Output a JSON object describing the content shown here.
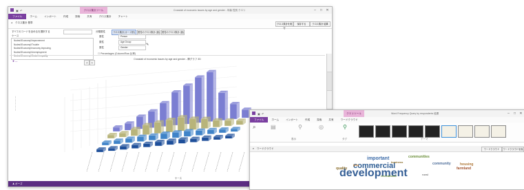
{
  "window1": {
    "title": "Crosstab of economic issues by age and gender - 年齢 性別 クエリ",
    "context_tab": "クロス集計ツール",
    "tabs": [
      "ファイル",
      "ホーム",
      "インポート",
      "作成",
      "探索",
      "共有",
      "クロス集計",
      "チャート"
    ],
    "query_label": "クロス集計 基準",
    "checkbox_label": "すべてのコードを含めるを選択する",
    "codes_label": "ケース",
    "codes": [
      "Nodes\\\\Economy\\\\Improvement",
      "Nodes\\\\Economy\\\\Trouble",
      "Nodes\\\\Economy\\\\economy improving",
      "Nodes\\\\Economy\\\\Unemployment",
      "Nodes\\\\Economy\\\\Social Inequality"
    ],
    "attributes_label": "分類属性",
    "attribute_rows": [
      {
        "label": "属性",
        "value": "Person"
      },
      {
        "label": "属性",
        "value": "Age Group"
      },
      {
        "label": "属性",
        "value": "Gender"
      }
    ],
    "buttons": {
      "b1": "クロス集計 (ケース別)",
      "b2": "属性のクロス集計 (値)",
      "b3": "属性のクロス集計 (値)",
      "run": "クロス集計を実行",
      "save": "保存する",
      "results": "クロス集計 結果"
    },
    "percent_label": "Percentages (Column/Row 比率)",
    "chart_title": "Crosstab of economic issues by age and gender - 棒グラフ 3D",
    "right_tabs": [
      "サマリー",
      "チャート",
      "マトリックス"
    ],
    "status": "ポーズ",
    "axis_label": "ケース"
  },
  "window2": {
    "title": "Word Frequency Query by respondents 結果",
    "context_tab": "クエリツール",
    "tabs": [
      "ファイル",
      "ホーム",
      "インポート",
      "作成",
      "探索",
      "共有",
      "ワードクラウド"
    ],
    "ribbon_groups": [
      "表示",
      "タグ",
      "テーマ"
    ],
    "thumb_count": 9,
    "panel_label": "ワードクラウド",
    "right_buttons": [
      "ワードクラウド",
      "ワードクラウドを保存"
    ],
    "words": [
      "important",
      "communities",
      "commercial",
      "development",
      "quality",
      "farmland",
      "housing",
      "recreational",
      "jobs",
      "rural",
      "community",
      "business"
    ]
  },
  "colors": {
    "accent": "#7a3fa0",
    "context": "#e9b4d9",
    "status_bar": "#5b2c82",
    "bar_front": "#1e4f9a",
    "bar_olive": "#b8b47a",
    "bar_lavender": "#7b7ed2",
    "bar_blue": "#3f83c8"
  },
  "icons": [
    "app-logo-icon",
    "save-icon",
    "undo-icon",
    "minimize-icon",
    "maximize-icon",
    "close-icon",
    "pin-icon",
    "search-icon",
    "wordcloud-icon"
  ]
}
